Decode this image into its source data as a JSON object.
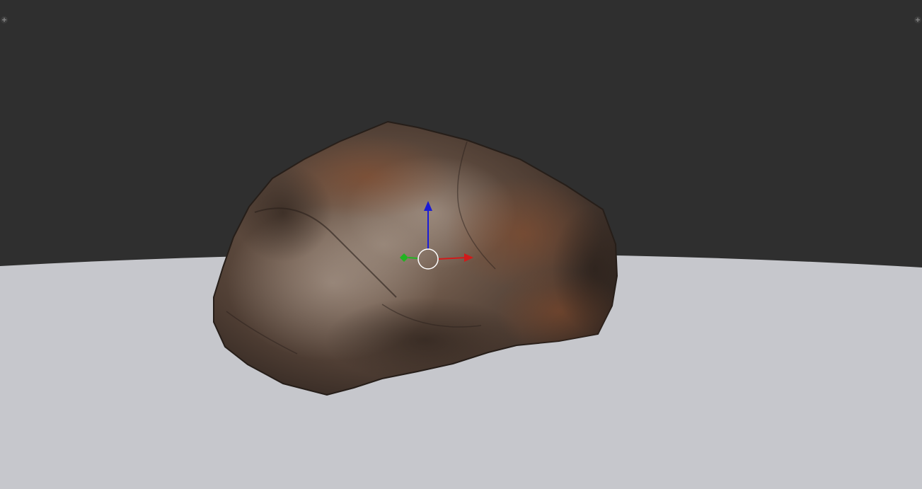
{
  "viewport": {
    "background_color": "#2f2f2f",
    "ground_color": "#c6c7cc",
    "object": "rock",
    "object_colors": {
      "dark": "#3e322b",
      "mid": "#6e5a4c",
      "light": "#9c8a7c",
      "rust": "#7d4a2f"
    },
    "gizmo": {
      "type": "transform",
      "axes": [
        {
          "axis": "x",
          "color": "#d11a1a"
        },
        {
          "axis": "y",
          "color": "#22b422"
        },
        {
          "axis": "z",
          "color": "#1a1ad6"
        }
      ],
      "center_ring_color": "#ffffff"
    },
    "corner_widgets": [
      {
        "side": "left",
        "icon": "plus-icon"
      },
      {
        "side": "right",
        "icon": "plus-icon"
      }
    ]
  }
}
